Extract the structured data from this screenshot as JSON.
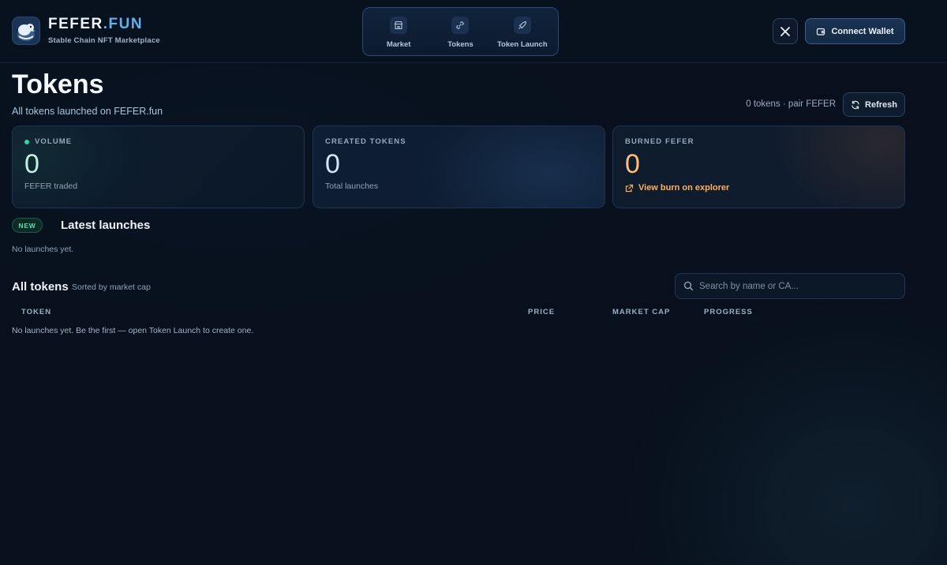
{
  "header": {
    "brand_name_main": "FEFER",
    "brand_name_accent": ".FUN",
    "brand_subtitle": "Stable Chain NFT Marketplace",
    "nav": [
      {
        "label": "Market",
        "icon": "store-icon"
      },
      {
        "label": "Tokens",
        "icon": "link-icon"
      },
      {
        "label": "Token Launch",
        "icon": "rocket-icon"
      }
    ],
    "connect_wallet": "Connect Wallet"
  },
  "page": {
    "title": "Tokens",
    "subtitle": "All tokens launched on FEFER.fun",
    "token_count": "0 tokens · pair FEFER",
    "refresh": "Refresh"
  },
  "stats": {
    "volume": {
      "label": "VOLUME",
      "value": "0",
      "foot": "FEFER traded"
    },
    "created": {
      "label": "CREATED TOKENS",
      "value": "0",
      "foot": "Total launches"
    },
    "burned": {
      "label": "BURNED FEFER",
      "value": "0",
      "link": "View burn on explorer"
    }
  },
  "latest": {
    "badge": "NEW",
    "title": "Latest launches",
    "empty": "No launches yet."
  },
  "all_tokens": {
    "title": "All tokens",
    "subtitle": "Sorted by market cap",
    "search_placeholder": "Search by name or CA...",
    "columns": [
      "TOKEN",
      "PRICE",
      "MARKET CAP",
      "PROGRESS"
    ],
    "empty": "No launches yet. Be the first — open Token Launch to create one."
  },
  "colors": {
    "accent": "#5fb2f0",
    "volume_value": "#bff2dc",
    "burn_value": "#ffbf7a",
    "burn_link": "#ffae5c",
    "new_badge": "#5be3a8"
  }
}
